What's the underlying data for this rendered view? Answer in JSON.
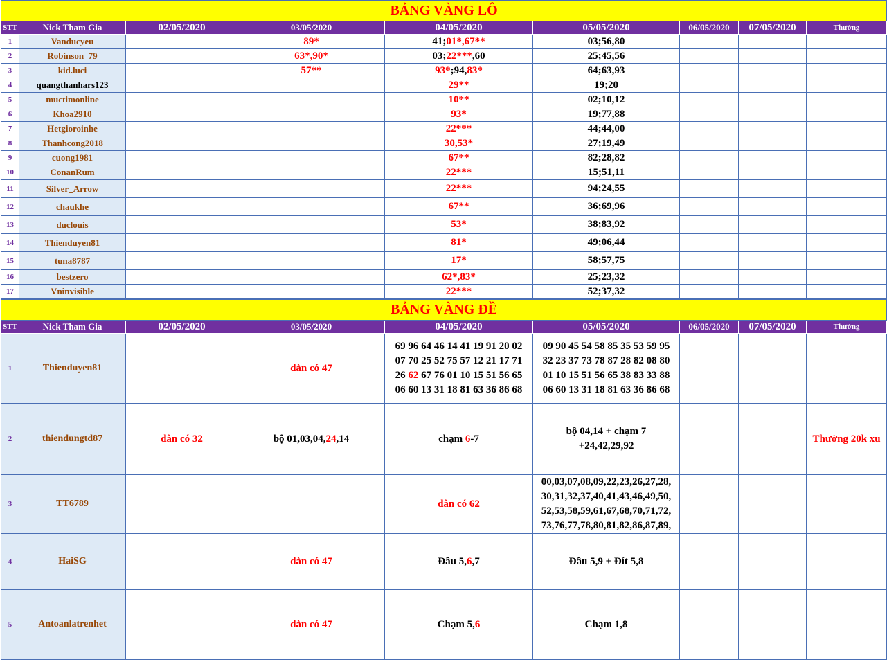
{
  "lo": {
    "title": "BẢNG VÀNG LÔ",
    "headers": [
      "STT",
      "Nick Tham Gia",
      "02/05/2020",
      "03/05/2020",
      "04/05/2020",
      "05/05/2020",
      "06/05/2020",
      "07/05/2020",
      "Thưởng"
    ],
    "rows": [
      {
        "stt": "1",
        "nick": "Vanducyeu",
        "d0305": "89*",
        "d0405a": "41;",
        "d0405b": "01*,67**",
        "d0505": "03;56,80"
      },
      {
        "stt": "2",
        "nick": "Robinson_79",
        "d0305": "63*,90*",
        "d0405a": "03;",
        "d0405b": "22***",
        "d0405c": ",60",
        "d0505": "25;45,56"
      },
      {
        "stt": "3",
        "nick": "kid.luci",
        "d0305": "57**",
        "d0405b": "93*",
        "d0405a": ";94,",
        "d0405c": "83*",
        "d0505": "64;63,93"
      },
      {
        "stt": "4",
        "nick": "quangthanhars123",
        "d0405b": "29**",
        "d0505": "19;20"
      },
      {
        "stt": "5",
        "nick": "muctimonline",
        "d0405b": "10**",
        "d0505": "02;10,12"
      },
      {
        "stt": "6",
        "nick": "Khoa2910",
        "d0405b": "93*",
        "d0505": "19;77,88"
      },
      {
        "stt": "7",
        "nick": "Hetgioroinhe",
        "d0405b": "22***",
        "d0505": "44;44,00"
      },
      {
        "stt": "8",
        "nick": "Thanhcong2018",
        "d0405b": "30,53*",
        "d0505": "27;19,49"
      },
      {
        "stt": "9",
        "nick": "cuong1981",
        "d0405b": "67**",
        "d0505": "82;28,82"
      },
      {
        "stt": "10",
        "nick": "ConanRum",
        "d0405b": "22***",
        "d0505": "15;51,11"
      },
      {
        "stt": "11",
        "nick": "Silver_Arrow",
        "d0405b": "22***",
        "d0505": "94;24,55"
      },
      {
        "stt": "12",
        "nick": "chaukhe",
        "d0405b": "67**",
        "d0505": "36;69,96"
      },
      {
        "stt": "13",
        "nick": "duclouis",
        "d0405b": "53*",
        "d0505": "38;83,92"
      },
      {
        "stt": "14",
        "nick": "Thienduyen81",
        "d0405b": "81*",
        "d0505": "49;06,44"
      },
      {
        "stt": "15",
        "nick": "tuna8787",
        "d0405b": "17*",
        "d0505": "58;57,75"
      },
      {
        "stt": "16",
        "nick": "bestzero",
        "d0405b": "62*,83*",
        "d0505": "25;23,32"
      },
      {
        "stt": "17",
        "nick": "Vninvisible",
        "d0405b": "22***",
        "d0505": "52;37,32"
      }
    ]
  },
  "de": {
    "title": "BẢNG VÀNG ĐỀ",
    "headers": [
      "STT",
      "Nick Tham Gia",
      "02/05/2020",
      "03/05/2020",
      "04/05/2020",
      "05/05/2020",
      "06/05/2020",
      "07/05/2020",
      "Thưởng"
    ],
    "rows": [
      {
        "stt": "1",
        "nick": "Thienduyen81",
        "d0305": "dàn có 47",
        "d0405_lines": [
          "69 96 64 46 14 41 19 91 20 02",
          "07 70 25 52 75 57 12 21 17 71",
          "26 ",
          "62",
          " 67 76 01 10 15 51 56 65",
          "06 60 13 31 18 81 63 36 86 68"
        ],
        "d0505_lines": [
          "09 90 45 54 58 85 35 53 59 95",
          "32 23 37 73 78 87 28 82 08 80",
          "01 10 15 51 56 65 38 83 33 88",
          "06 60 13 31 18 81 63 36 86 68"
        ]
      },
      {
        "stt": "2",
        "nick": "thiendungtd87",
        "d0205": "dàn có 32",
        "d0305a": "bộ 01,03,04,",
        "d0305b": "24",
        "d0305c": ",14",
        "d0405a": "chạm ",
        "d0405b": "6",
        "d0405c": "-7",
        "d0505a": "bộ 04,14 + chạm 7",
        "d0505b": "+24,42,29,92",
        "thuong": "Thưởng 20k xu"
      },
      {
        "stt": "3",
        "nick": "TT6789",
        "d0405": "dàn có 62",
        "d0505_lines": [
          "00,03,07,08,09,22,23,26,27,28,",
          "30,31,32,37,40,41,43,46,49,50,",
          "52,53,58,59,61,67,68,70,71,72,",
          "73,76,77,78,80,81,82,86,87,89,"
        ]
      },
      {
        "stt": "4",
        "nick": "HaiSG",
        "d0305": "dàn có 47",
        "d0405a": "Đầu 5,",
        "d0405b": "6",
        "d0405c": ",7",
        "d0505": "Đầu 5,9 + Đít 5,8"
      },
      {
        "stt": "5",
        "nick": "Antoanlatrenhet",
        "d0305": "dàn có 47",
        "d0405a": "Chạm 5,",
        "d0405b": "6",
        "d0505": "Chạm 1,8"
      }
    ]
  }
}
